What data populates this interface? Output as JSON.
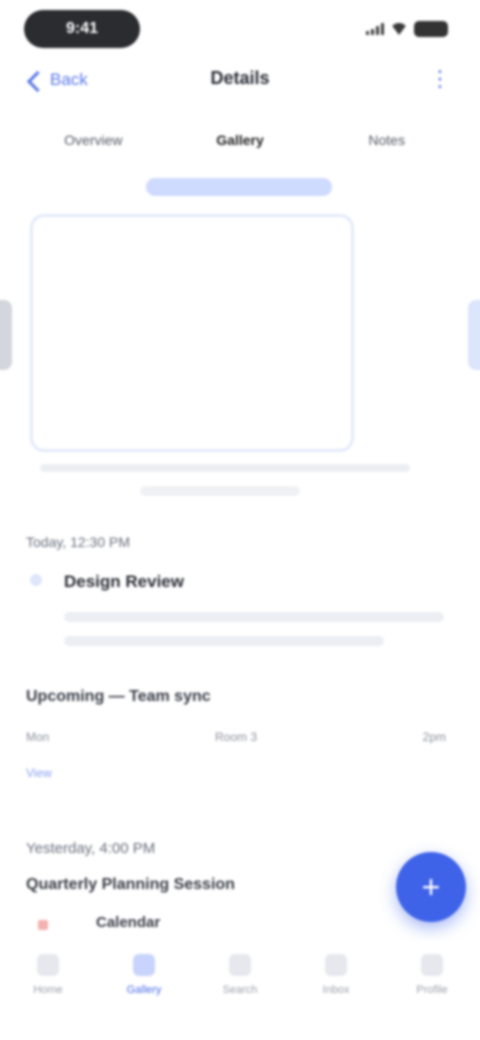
{
  "status_bar": {
    "time": "9:41"
  },
  "nav": {
    "back_label": "Back",
    "title": "Details",
    "action_icon": "more-icon"
  },
  "tabs": [
    {
      "label": "Overview",
      "active": false
    },
    {
      "label": "Gallery",
      "active": true
    },
    {
      "label": "Notes",
      "active": false
    }
  ],
  "card": {
    "caption": ""
  },
  "section1": {
    "title": "Today, 12:30 PM",
    "heading": "Design Review"
  },
  "section2": {
    "title": "Upcoming — Team sync",
    "col1": "Mon",
    "col2": "Room 3",
    "col3": "2pm",
    "link": "View"
  },
  "section3": {
    "title": "Yesterday, 4:00 PM",
    "subtitle": "Quarterly Planning Session"
  },
  "fab": {
    "label": "+"
  },
  "bottom": {
    "label": "Calendar"
  },
  "tabbar": [
    {
      "label": "Home"
    },
    {
      "label": "Gallery"
    },
    {
      "label": "Search"
    },
    {
      "label": "Inbox"
    },
    {
      "label": "Profile"
    }
  ],
  "colors": {
    "accent": "#3f63e8",
    "link": "#5b78e8"
  }
}
